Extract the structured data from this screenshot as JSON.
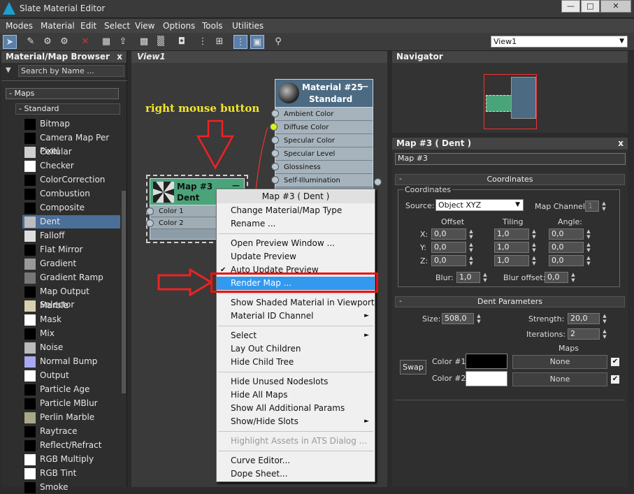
{
  "window": {
    "title": "Slate Material Editor",
    "min": "—",
    "max": "□",
    "close": "✕"
  },
  "menu": [
    "Modes",
    "Material",
    "Edit",
    "Select",
    "View",
    "Options",
    "Tools",
    "Utilities"
  ],
  "toolbar": {
    "view_selected": "View1"
  },
  "browser": {
    "title": "Material/Map Browser",
    "close": "x",
    "search_placeholder": "Search by Name ...",
    "group_maps": "- Maps",
    "group_standard": "- Standard",
    "items": [
      {
        "label": "Bitmap",
        "swatch": "#000000"
      },
      {
        "label": "Camera Map Per Pixel",
        "swatch": "#000000"
      },
      {
        "label": "Cellular",
        "swatch": "#cfcfcf"
      },
      {
        "label": "Checker",
        "swatch": "#ffffff"
      },
      {
        "label": "ColorCorrection",
        "swatch": "#000000"
      },
      {
        "label": "Combustion",
        "swatch": "#000000"
      },
      {
        "label": "Composite",
        "swatch": "#000000"
      },
      {
        "label": "Dent",
        "swatch": "#bdbdbd"
      },
      {
        "label": "Falloff",
        "swatch": "#dedede"
      },
      {
        "label": "Flat Mirror",
        "swatch": "#000000"
      },
      {
        "label": "Gradient",
        "swatch": "#999999"
      },
      {
        "label": "Gradient Ramp",
        "swatch": "#777777"
      },
      {
        "label": "Map Output Selector",
        "swatch": "#000000"
      },
      {
        "label": "Marble",
        "swatch": "#d8d2b0"
      },
      {
        "label": "Mask",
        "swatch": "#ffffff"
      },
      {
        "label": "Mix",
        "swatch": "#000000"
      },
      {
        "label": "Noise",
        "swatch": "#bbbbbb"
      },
      {
        "label": "Normal Bump",
        "swatch": "#a9a9f2"
      },
      {
        "label": "Output",
        "swatch": "#ffffff"
      },
      {
        "label": "Particle Age",
        "swatch": "#000000"
      },
      {
        "label": "Particle MBlur",
        "swatch": "#000000"
      },
      {
        "label": "Perlin Marble",
        "swatch": "#a9a98a"
      },
      {
        "label": "Raytrace",
        "swatch": "#000000"
      },
      {
        "label": "Reflect/Refract",
        "swatch": "#000000"
      },
      {
        "label": "RGB Multiply",
        "swatch": "#ffffff"
      },
      {
        "label": "RGB Tint",
        "swatch": "#ffffff"
      },
      {
        "label": "Smoke",
        "swatch": "#000000"
      }
    ]
  },
  "view1": {
    "tab": "View1",
    "annotation": "right mouse button",
    "material_node": {
      "title": "Material #25",
      "subtitle": "Standard",
      "slots": [
        "Ambient Color",
        "Diffuse Color",
        "Specular Color",
        "Specular Level",
        "Glossiness",
        "Self-Illumination"
      ]
    },
    "map_node": {
      "title": "Map #3",
      "subtitle": "Dent",
      "collapse": "—",
      "slots": [
        "Color 1",
        "Color 2"
      ]
    }
  },
  "context_menu": {
    "header": "Map #3  ( Dent )",
    "items": [
      {
        "label": "Change Material/Map Type"
      },
      {
        "label": "Rename ..."
      },
      {
        "sep": true
      },
      {
        "label": "Open Preview Window ..."
      },
      {
        "label": "Update Preview"
      },
      {
        "label": "Auto Update Preview",
        "check": "✔"
      },
      {
        "label": "Render Map ...",
        "highlight": true
      },
      {
        "sep": true
      },
      {
        "label": "Show Shaded Material in Viewport"
      },
      {
        "label": "Material ID Channel",
        "sub": "►"
      },
      {
        "sep": true
      },
      {
        "label": "Select",
        "sub": "►"
      },
      {
        "label": "Lay Out Children"
      },
      {
        "label": "Hide Child Tree"
      },
      {
        "sep": true
      },
      {
        "label": "Hide Unused Nodeslots"
      },
      {
        "label": "Hide All Maps"
      },
      {
        "label": "Show All Additional Params"
      },
      {
        "label": "Show/Hide Slots",
        "sub": "►"
      },
      {
        "sep": true
      },
      {
        "label": "Highlight Assets in ATS Dialog ...",
        "disabled": true
      },
      {
        "sep": true
      },
      {
        "label": "Curve Editor..."
      },
      {
        "label": "Dope Sheet..."
      }
    ]
  },
  "navigator": {
    "title": "Navigator",
    "close": "x"
  },
  "params": {
    "title": "Map #3  ( Dent )",
    "close": "x",
    "name_field": "Map #3",
    "coords": {
      "rollout": "Coordinates",
      "group": "Coordinates",
      "source_label": "Source:",
      "source_value": "Object XYZ",
      "channel_label": "Map Channel:",
      "channel_value": "1",
      "col_offset": "Offset",
      "col_tiling": "Tiling",
      "col_angle": "Angle:",
      "rows": [
        {
          "axis": "X:",
          "offset": "0,0",
          "tiling": "1,0",
          "angle": "0,0"
        },
        {
          "axis": "Y:",
          "offset": "0,0",
          "tiling": "1,0",
          "angle": "0,0"
        },
        {
          "axis": "Z:",
          "offset": "0,0",
          "tiling": "1,0",
          "angle": "0,0"
        }
      ],
      "blur_label": "Blur:",
      "blur_value": "1,0",
      "blur_offset_label": "Blur offset:",
      "blur_offset_value": "0,0"
    },
    "dent": {
      "rollout": "Dent Parameters",
      "size_label": "Size:",
      "size_value": "508,0",
      "strength_label": "Strength:",
      "strength_value": "20,0",
      "iterations_label": "Iterations:",
      "iterations_value": "2",
      "maps_label": "Maps",
      "swap": "Swap",
      "color1_label": "Color #1",
      "color1": "#000000",
      "color2_label": "Color #2",
      "color2": "#ffffff",
      "map1": "None",
      "map2": "None",
      "check": "✔"
    }
  }
}
